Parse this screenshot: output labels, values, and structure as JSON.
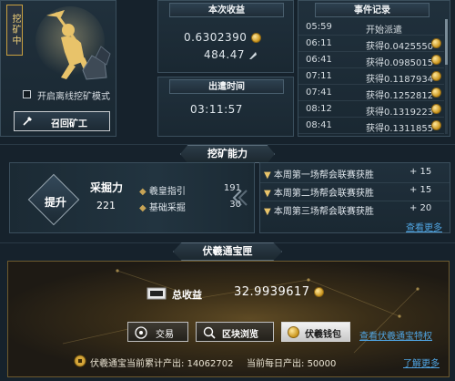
{
  "miner": {
    "status_badge": "挖矿中",
    "offline_toggle_label": "开启离线挖矿模式",
    "recall_button": "召回矿工"
  },
  "earnings": {
    "title": "本次收益",
    "value1": "0.6302390",
    "value2": "484.47"
  },
  "dispatch": {
    "title": "出遣时间",
    "time": "03:11:57"
  },
  "events": {
    "title": "事件记录",
    "rows": [
      {
        "time": "05:59",
        "text": "开始派遣",
        "coin": false
      },
      {
        "time": "06:11",
        "text": "获得0.0425550",
        "coin": true
      },
      {
        "time": "06:41",
        "text": "获得0.0985015",
        "coin": true
      },
      {
        "time": "07:11",
        "text": "获得0.1187934",
        "coin": true
      },
      {
        "time": "07:41",
        "text": "获得0.1252812",
        "coin": true
      },
      {
        "time": "08:12",
        "text": "获得0.1319223",
        "coin": true
      },
      {
        "time": "08:41",
        "text": "获得0.1311855",
        "coin": true
      }
    ]
  },
  "ability": {
    "title": "挖矿能力",
    "boost_button": "提升",
    "power_label": "采掘力",
    "power_value": "221",
    "stats": [
      {
        "label": "羲皇指引",
        "value": "191"
      },
      {
        "label": "基础采掘",
        "value": "30"
      }
    ],
    "bonuses": [
      {
        "text": "本周第一场帮会联赛获胜",
        "value": "+ 15"
      },
      {
        "text": "本周第二场帮会联赛获胜",
        "value": "+ 15"
      },
      {
        "text": "本周第三场帮会联赛获胜",
        "value": "+ 20"
      }
    ],
    "more_link": "查看更多"
  },
  "treasury": {
    "title": "伏羲通宝匣",
    "total_label": "总收益",
    "total_value": "32.9939617",
    "trade_button": "交易",
    "block_button": "区块浏览",
    "wallet_button": "伏羲钱包",
    "privilege_link": "查看伏羲通宝特权",
    "cumulative_label": "伏羲通宝当前累计产出:",
    "cumulative_value": "14062702",
    "daily_label": "当前每日产出:",
    "daily_value": "50000",
    "learn_more": "了解更多"
  },
  "colors": {
    "accent_gold": "#e9c46a",
    "link_blue": "#4fa3e0",
    "panel_bg": "#1a2832"
  }
}
